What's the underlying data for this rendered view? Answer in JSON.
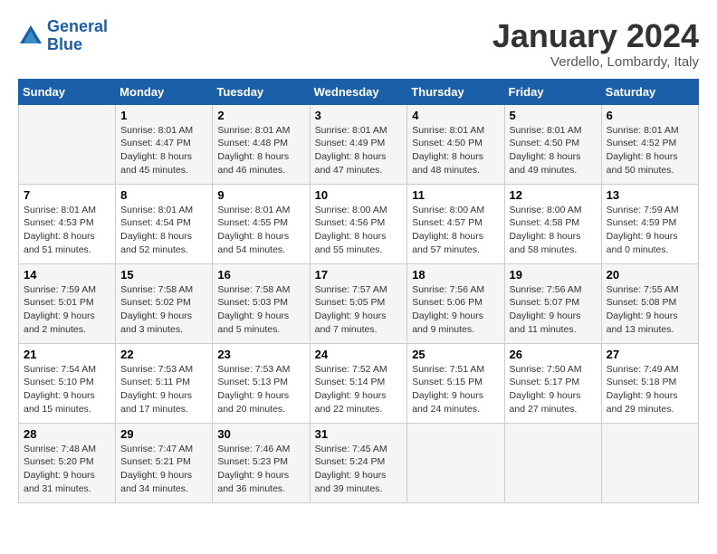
{
  "logo": {
    "line1": "General",
    "line2": "Blue"
  },
  "header": {
    "month": "January 2024",
    "location": "Verdello, Lombardy, Italy"
  },
  "weekdays": [
    "Sunday",
    "Monday",
    "Tuesday",
    "Wednesday",
    "Thursday",
    "Friday",
    "Saturday"
  ],
  "weeks": [
    [
      {
        "day": "",
        "sunrise": "",
        "sunset": "",
        "daylight": ""
      },
      {
        "day": "1",
        "sunrise": "Sunrise: 8:01 AM",
        "sunset": "Sunset: 4:47 PM",
        "daylight": "Daylight: 8 hours and 45 minutes."
      },
      {
        "day": "2",
        "sunrise": "Sunrise: 8:01 AM",
        "sunset": "Sunset: 4:48 PM",
        "daylight": "Daylight: 8 hours and 46 minutes."
      },
      {
        "day": "3",
        "sunrise": "Sunrise: 8:01 AM",
        "sunset": "Sunset: 4:49 PM",
        "daylight": "Daylight: 8 hours and 47 minutes."
      },
      {
        "day": "4",
        "sunrise": "Sunrise: 8:01 AM",
        "sunset": "Sunset: 4:50 PM",
        "daylight": "Daylight: 8 hours and 48 minutes."
      },
      {
        "day": "5",
        "sunrise": "Sunrise: 8:01 AM",
        "sunset": "Sunset: 4:50 PM",
        "daylight": "Daylight: 8 hours and 49 minutes."
      },
      {
        "day": "6",
        "sunrise": "Sunrise: 8:01 AM",
        "sunset": "Sunset: 4:52 PM",
        "daylight": "Daylight: 8 hours and 50 minutes."
      }
    ],
    [
      {
        "day": "7",
        "sunrise": "Sunrise: 8:01 AM",
        "sunset": "Sunset: 4:53 PM",
        "daylight": "Daylight: 8 hours and 51 minutes."
      },
      {
        "day": "8",
        "sunrise": "Sunrise: 8:01 AM",
        "sunset": "Sunset: 4:54 PM",
        "daylight": "Daylight: 8 hours and 52 minutes."
      },
      {
        "day": "9",
        "sunrise": "Sunrise: 8:01 AM",
        "sunset": "Sunset: 4:55 PM",
        "daylight": "Daylight: 8 hours and 54 minutes."
      },
      {
        "day": "10",
        "sunrise": "Sunrise: 8:00 AM",
        "sunset": "Sunset: 4:56 PM",
        "daylight": "Daylight: 8 hours and 55 minutes."
      },
      {
        "day": "11",
        "sunrise": "Sunrise: 8:00 AM",
        "sunset": "Sunset: 4:57 PM",
        "daylight": "Daylight: 8 hours and 57 minutes."
      },
      {
        "day": "12",
        "sunrise": "Sunrise: 8:00 AM",
        "sunset": "Sunset: 4:58 PM",
        "daylight": "Daylight: 8 hours and 58 minutes."
      },
      {
        "day": "13",
        "sunrise": "Sunrise: 7:59 AM",
        "sunset": "Sunset: 4:59 PM",
        "daylight": "Daylight: 9 hours and 0 minutes."
      }
    ],
    [
      {
        "day": "14",
        "sunrise": "Sunrise: 7:59 AM",
        "sunset": "Sunset: 5:01 PM",
        "daylight": "Daylight: 9 hours and 2 minutes."
      },
      {
        "day": "15",
        "sunrise": "Sunrise: 7:58 AM",
        "sunset": "Sunset: 5:02 PM",
        "daylight": "Daylight: 9 hours and 3 minutes."
      },
      {
        "day": "16",
        "sunrise": "Sunrise: 7:58 AM",
        "sunset": "Sunset: 5:03 PM",
        "daylight": "Daylight: 9 hours and 5 minutes."
      },
      {
        "day": "17",
        "sunrise": "Sunrise: 7:57 AM",
        "sunset": "Sunset: 5:05 PM",
        "daylight": "Daylight: 9 hours and 7 minutes."
      },
      {
        "day": "18",
        "sunrise": "Sunrise: 7:56 AM",
        "sunset": "Sunset: 5:06 PM",
        "daylight": "Daylight: 9 hours and 9 minutes."
      },
      {
        "day": "19",
        "sunrise": "Sunrise: 7:56 AM",
        "sunset": "Sunset: 5:07 PM",
        "daylight": "Daylight: 9 hours and 11 minutes."
      },
      {
        "day": "20",
        "sunrise": "Sunrise: 7:55 AM",
        "sunset": "Sunset: 5:08 PM",
        "daylight": "Daylight: 9 hours and 13 minutes."
      }
    ],
    [
      {
        "day": "21",
        "sunrise": "Sunrise: 7:54 AM",
        "sunset": "Sunset: 5:10 PM",
        "daylight": "Daylight: 9 hours and 15 minutes."
      },
      {
        "day": "22",
        "sunrise": "Sunrise: 7:53 AM",
        "sunset": "Sunset: 5:11 PM",
        "daylight": "Daylight: 9 hours and 17 minutes."
      },
      {
        "day": "23",
        "sunrise": "Sunrise: 7:53 AM",
        "sunset": "Sunset: 5:13 PM",
        "daylight": "Daylight: 9 hours and 20 minutes."
      },
      {
        "day": "24",
        "sunrise": "Sunrise: 7:52 AM",
        "sunset": "Sunset: 5:14 PM",
        "daylight": "Daylight: 9 hours and 22 minutes."
      },
      {
        "day": "25",
        "sunrise": "Sunrise: 7:51 AM",
        "sunset": "Sunset: 5:15 PM",
        "daylight": "Daylight: 9 hours and 24 minutes."
      },
      {
        "day": "26",
        "sunrise": "Sunrise: 7:50 AM",
        "sunset": "Sunset: 5:17 PM",
        "daylight": "Daylight: 9 hours and 27 minutes."
      },
      {
        "day": "27",
        "sunrise": "Sunrise: 7:49 AM",
        "sunset": "Sunset: 5:18 PM",
        "daylight": "Daylight: 9 hours and 29 minutes."
      }
    ],
    [
      {
        "day": "28",
        "sunrise": "Sunrise: 7:48 AM",
        "sunset": "Sunset: 5:20 PM",
        "daylight": "Daylight: 9 hours and 31 minutes."
      },
      {
        "day": "29",
        "sunrise": "Sunrise: 7:47 AM",
        "sunset": "Sunset: 5:21 PM",
        "daylight": "Daylight: 9 hours and 34 minutes."
      },
      {
        "day": "30",
        "sunrise": "Sunrise: 7:46 AM",
        "sunset": "Sunset: 5:23 PM",
        "daylight": "Daylight: 9 hours and 36 minutes."
      },
      {
        "day": "31",
        "sunrise": "Sunrise: 7:45 AM",
        "sunset": "Sunset: 5:24 PM",
        "daylight": "Daylight: 9 hours and 39 minutes."
      },
      {
        "day": "",
        "sunrise": "",
        "sunset": "",
        "daylight": ""
      },
      {
        "day": "",
        "sunrise": "",
        "sunset": "",
        "daylight": ""
      },
      {
        "day": "",
        "sunrise": "",
        "sunset": "",
        "daylight": ""
      }
    ]
  ]
}
